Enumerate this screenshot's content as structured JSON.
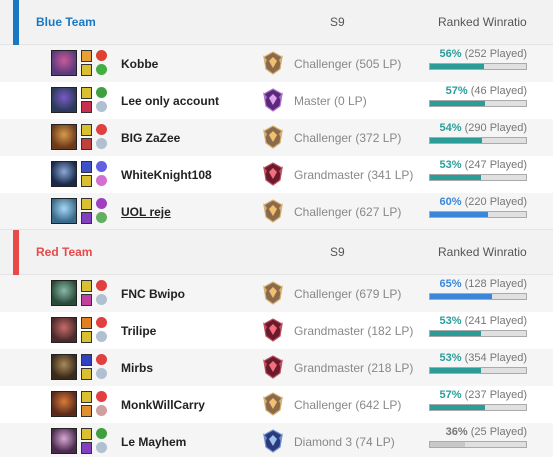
{
  "colors": {
    "blue_team": "#1a78c2",
    "red_team": "#e84a4a",
    "bar_teal": "#2a9d99",
    "bar_blue": "#3a86d8",
    "bar_grey": "#c8c8c8"
  },
  "teams": [
    {
      "name": "Blue Team",
      "season": "S9",
      "winratio_header": "Ranked Winratio",
      "players": [
        {
          "name": "Kobbe",
          "rank": "Challenger (505 LP)",
          "rank_icon": "challenger-icon",
          "winrate_pct": "56%",
          "played": "(252 Played)",
          "winrate": 56,
          "highlight": false,
          "champion_icon": "champion-portrait-icon"
        },
        {
          "name": "Lee only account",
          "rank": "Master (0 LP)",
          "rank_icon": "master-icon",
          "winrate_pct": "57%",
          "played": "(46 Played)",
          "winrate": 57,
          "highlight": false,
          "champion_icon": "champion-portrait-icon"
        },
        {
          "name": "BIG ZaZee",
          "rank": "Challenger (372 LP)",
          "rank_icon": "challenger-icon",
          "winrate_pct": "54%",
          "played": "(290 Played)",
          "winrate": 54,
          "highlight": false,
          "champion_icon": "champion-portrait-icon"
        },
        {
          "name": "WhiteKnight108",
          "rank": "Grandmaster (341 LP)",
          "rank_icon": "grandmaster-icon",
          "winrate_pct": "53%",
          "played": "(247 Played)",
          "winrate": 53,
          "highlight": false,
          "champion_icon": "champion-portrait-icon"
        },
        {
          "name": "UOL reje",
          "rank": "Challenger (627 LP)",
          "rank_icon": "challenger-icon",
          "winrate_pct": "60%",
          "played": "(220 Played)",
          "winrate": 60,
          "highlight": true,
          "champion_icon": "champion-portrait-icon"
        }
      ]
    },
    {
      "name": "Red Team",
      "season": "S9",
      "winratio_header": "Ranked Winratio",
      "players": [
        {
          "name": "FNC Bwipo",
          "rank": "Challenger (679 LP)",
          "rank_icon": "challenger-icon",
          "winrate_pct": "65%",
          "played": "(128 Played)",
          "winrate": 65,
          "highlight": true,
          "champion_icon": "champion-portrait-icon"
        },
        {
          "name": "Trilipe",
          "rank": "Grandmaster (182 LP)",
          "rank_icon": "grandmaster-icon",
          "winrate_pct": "53%",
          "played": "(241 Played)",
          "winrate": 53,
          "highlight": false,
          "champion_icon": "champion-portrait-icon"
        },
        {
          "name": "Mirbs",
          "rank": "Grandmaster (218 LP)",
          "rank_icon": "grandmaster-icon",
          "winrate_pct": "53%",
          "played": "(354 Played)",
          "winrate": 53,
          "highlight": false,
          "champion_icon": "champion-portrait-icon"
        },
        {
          "name": "MonkWillCarry",
          "rank": "Challenger (642 LP)",
          "rank_icon": "challenger-icon",
          "winrate_pct": "57%",
          "played": "(237 Played)",
          "winrate": 57,
          "highlight": false,
          "champion_icon": "champion-portrait-icon"
        },
        {
          "name": "Le Mayhem",
          "rank": "Diamond 3 (74 LP)",
          "rank_icon": "diamond-icon",
          "winrate_pct": "36%",
          "played": "(25 Played)",
          "winrate": 36,
          "highlight": false,
          "champion_icon": "champion-portrait-icon"
        }
      ]
    }
  ]
}
